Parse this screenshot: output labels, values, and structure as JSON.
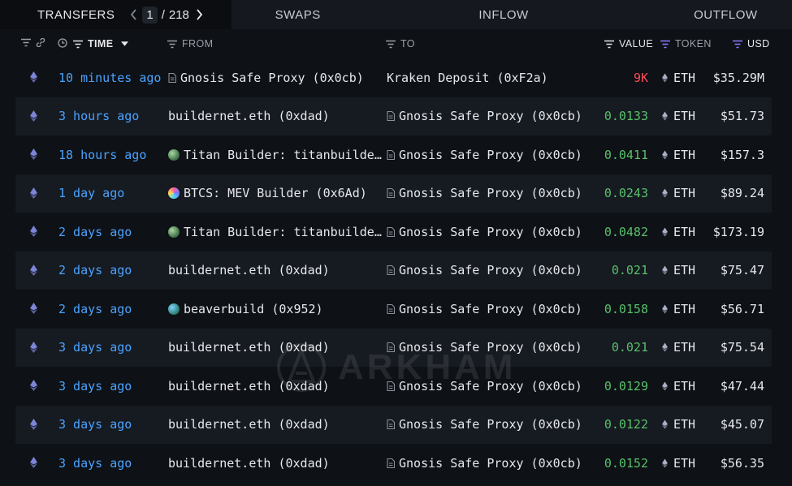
{
  "tabs": {
    "transfers": "TRANSFERS",
    "swaps": "SWAPS",
    "inflow": "INFLOW",
    "outflow": "OUTFLOW"
  },
  "pager": {
    "current": "1",
    "separator": "/",
    "total": "218"
  },
  "columns": {
    "time": "TIME",
    "from": "FROM",
    "to": "TO",
    "value": "VALUE",
    "token": "TOKEN",
    "usd": "USD"
  },
  "colors": {
    "accent_blue": "#4aa3ff",
    "value_green": "#58c06a",
    "value_red": "#ff4b55",
    "token_purple": "#8f7cff"
  },
  "rows": [
    {
      "time": "10 minutes ago",
      "from": "Gnosis Safe Proxy (0x0cb)",
      "from_icon": "doc-icon",
      "to": "Kraken Deposit (0xF2a)",
      "to_icon": "",
      "value": "9K",
      "value_color": "red",
      "token": "ETH",
      "usd": "$35.29M"
    },
    {
      "time": "3 hours ago",
      "from": "buildernet.eth (0xdad)",
      "from_icon": "",
      "to": "Gnosis Safe Proxy (0x0cb)",
      "to_icon": "doc-icon",
      "value": "0.0133",
      "value_color": "green",
      "token": "ETH",
      "usd": "$51.73"
    },
    {
      "time": "18 hours ago",
      "from": "Titan Builder: titanbuilder.xyz",
      "from_icon": "titan-orb-icon",
      "to": "Gnosis Safe Proxy (0x0cb)",
      "to_icon": "doc-icon",
      "value": "0.0411",
      "value_color": "green",
      "token": "ETH",
      "usd": "$157.3"
    },
    {
      "time": "1 day ago",
      "from": "BTCS: MEV Builder (0x6Ad)",
      "from_icon": "btcs-orb-icon",
      "to": "Gnosis Safe Proxy (0x0cb)",
      "to_icon": "doc-icon",
      "value": "0.0243",
      "value_color": "green",
      "token": "ETH",
      "usd": "$89.24"
    },
    {
      "time": "2 days ago",
      "from": "Titan Builder: titanbuilder.xyz",
      "from_icon": "titan-orb-icon",
      "to": "Gnosis Safe Proxy (0x0cb)",
      "to_icon": "doc-icon",
      "value": "0.0482",
      "value_color": "green",
      "token": "ETH",
      "usd": "$173.19"
    },
    {
      "time": "2 days ago",
      "from": "buildernet.eth (0xdad)",
      "from_icon": "",
      "to": "Gnosis Safe Proxy (0x0cb)",
      "to_icon": "doc-icon",
      "value": "0.021",
      "value_color": "green",
      "token": "ETH",
      "usd": "$75.47"
    },
    {
      "time": "2 days ago",
      "from": "beaverbuild (0x952)",
      "from_icon": "beaver-orb-icon",
      "to": "Gnosis Safe Proxy (0x0cb)",
      "to_icon": "doc-icon",
      "value": "0.0158",
      "value_color": "green",
      "token": "ETH",
      "usd": "$56.71"
    },
    {
      "time": "3 days ago",
      "from": "buildernet.eth (0xdad)",
      "from_icon": "",
      "to": "Gnosis Safe Proxy (0x0cb)",
      "to_icon": "doc-icon",
      "value": "0.021",
      "value_color": "green",
      "token": "ETH",
      "usd": "$75.54"
    },
    {
      "time": "3 days ago",
      "from": "buildernet.eth (0xdad)",
      "from_icon": "",
      "to": "Gnosis Safe Proxy (0x0cb)",
      "to_icon": "doc-icon",
      "value": "0.0129",
      "value_color": "green",
      "token": "ETH",
      "usd": "$47.44"
    },
    {
      "time": "3 days ago",
      "from": "buildernet.eth (0xdad)",
      "from_icon": "",
      "to": "Gnosis Safe Proxy (0x0cb)",
      "to_icon": "doc-icon",
      "value": "0.0122",
      "value_color": "green",
      "token": "ETH",
      "usd": "$45.07"
    },
    {
      "time": "3 days ago",
      "from": "buildernet.eth (0xdad)",
      "from_icon": "",
      "to": "Gnosis Safe Proxy (0x0cb)",
      "to_icon": "doc-icon",
      "value": "0.0152",
      "value_color": "green",
      "token": "ETH",
      "usd": "$56.35"
    }
  ],
  "watermark": "ARKHAM"
}
